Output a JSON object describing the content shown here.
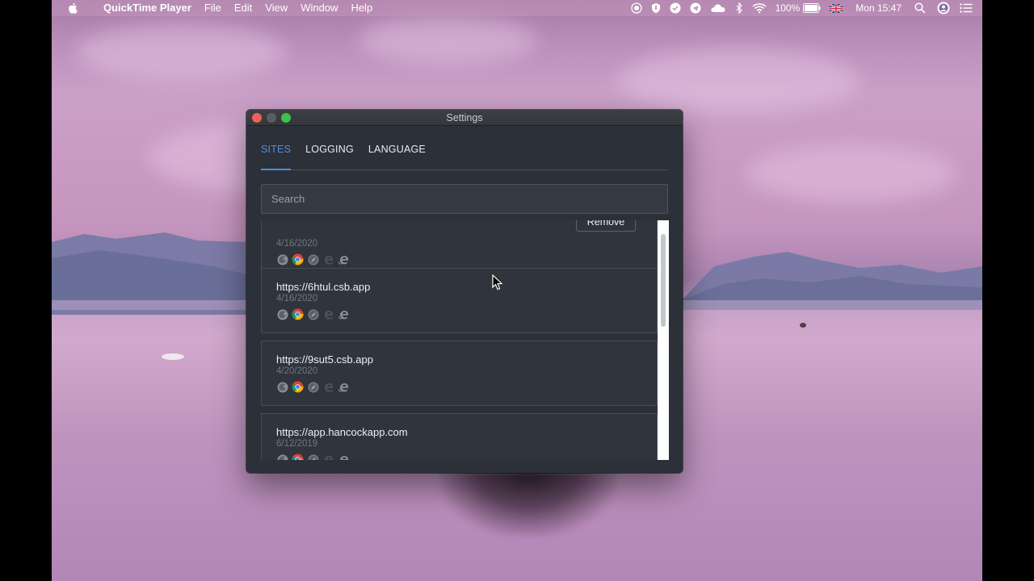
{
  "menubar": {
    "app_name": "QuickTime Player",
    "menus": [
      "File",
      "Edit",
      "View",
      "Window",
      "Help"
    ],
    "battery": "100%",
    "clock": "Mon 15:47",
    "status_icons": [
      "screen-record-icon",
      "shield-icon",
      "check-icon",
      "telegram-icon",
      "creative-cloud-icon",
      "bluetooth-icon",
      "wifi-icon",
      "battery-icon",
      "uk-flag-icon",
      "spotlight-search-icon",
      "user-avatar-icon",
      "notification-center-icon"
    ]
  },
  "window": {
    "title": "Settings",
    "tabs": [
      {
        "label": "SITES",
        "active": true
      },
      {
        "label": "LOGGING",
        "active": false
      },
      {
        "label": "LANGUAGE",
        "active": false
      }
    ],
    "search_placeholder": "Search",
    "remove_label": "Remove",
    "sites": [
      {
        "url": "",
        "date": "4/16/2020"
      },
      {
        "url": "https://6htul.csb.app",
        "date": "4/16/2020"
      },
      {
        "url": "https://9sut5.csb.app",
        "date": "4/20/2020"
      },
      {
        "url": "https://app.hancockapp.com",
        "date": "6/12/2019"
      }
    ],
    "browser_icons": [
      "firefox-icon",
      "chrome-icon",
      "safari-icon",
      "edge-icon",
      "internet-explorer-icon"
    ]
  },
  "colors": {
    "accent": "#4a90d9",
    "window_bg": "#2c3038",
    "card_bg": "#30353d"
  }
}
